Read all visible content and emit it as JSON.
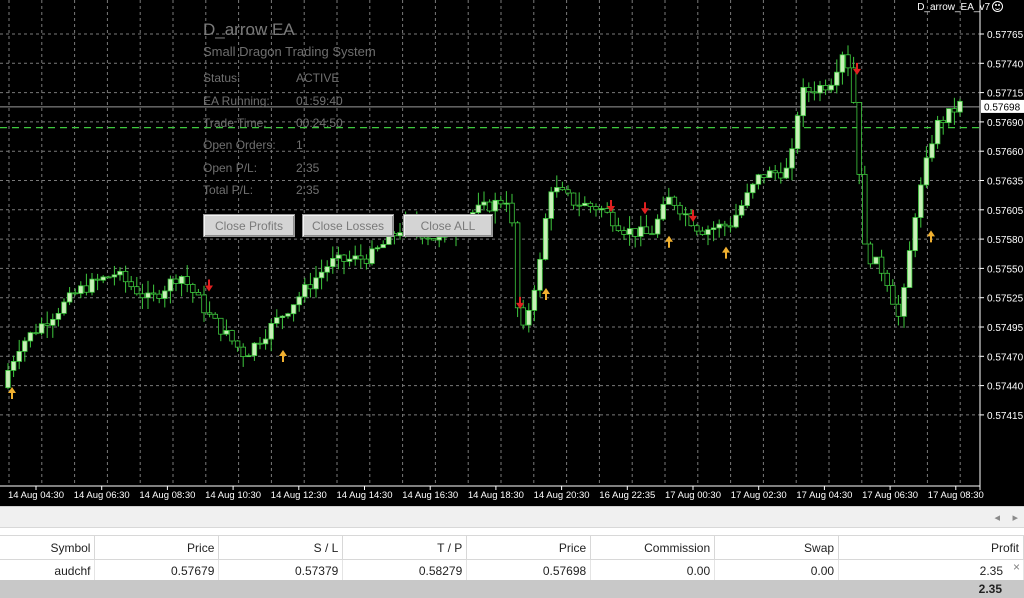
{
  "chart": {
    "indicator_label": "D_arrow_EA_v7",
    "bg_color": "#000000",
    "grid_color": "#7a7a7a",
    "bull_color": "#c8f0b8",
    "bear_color": "#000000",
    "wick_color": "#3ec83e",
    "price_levels": [
      "0.57765",
      "0.57740",
      "0.57715",
      "0.57690",
      "0.57660",
      "0.57635",
      "0.57605",
      "0.57580",
      "0.57550",
      "0.57525",
      "0.57495",
      "0.57470",
      "0.57440",
      "0.57415"
    ],
    "current_price_tag": "0.57698",
    "time_labels": [
      "14 Aug 04:30",
      "14 Aug 06:30",
      "14 Aug 08:30",
      "14 Aug 10:30",
      "14 Aug 12:30",
      "14 Aug 14:30",
      "14 Aug 16:30",
      "14 Aug 18:30",
      "14 Aug 20:30",
      "16 Aug 22:35",
      "17 Aug 00:30",
      "17 Aug 02:30",
      "17 Aug 04:30",
      "17 Aug 06:30",
      "17 Aug 08:30"
    ],
    "down_arrow_color": "#e02020",
    "up_arrow_color": "#f0b030",
    "trade_line_color": "#3ec83e"
  },
  "ea": {
    "title": "D_arrow EA",
    "subtitle": "Small Dragon Trading System",
    "rows": [
      {
        "key": "Status:",
        "value": "ACTIVE"
      },
      {
        "key": "EA Running:",
        "value": "01:59:40"
      },
      {
        "key": "Trade Time:",
        "value": "00:24:50"
      },
      {
        "key": "Open Orders:",
        "value": "1"
      },
      {
        "key": "Open P/L:",
        "value": "2.35"
      },
      {
        "key": "Total P/L:",
        "value": "2.35"
      }
    ],
    "buttons": {
      "close_profits": "Close Profits",
      "close_losses": "Close Losses",
      "close_all": "Close ALL"
    }
  },
  "terminal": {
    "headers": [
      "Symbol",
      "Price",
      "S / L",
      "T / P",
      "Price",
      "Commission",
      "Swap",
      "Profit"
    ],
    "rows": [
      [
        "audchf",
        "0.57679",
        "0.57379",
        "0.58279",
        "0.57698",
        "0.00",
        "0.00",
        "2.35"
      ]
    ],
    "total": "2.35",
    "close_icon": "×",
    "scroll_left_icon": "◂",
    "scroll_right_icon": "▸"
  }
}
